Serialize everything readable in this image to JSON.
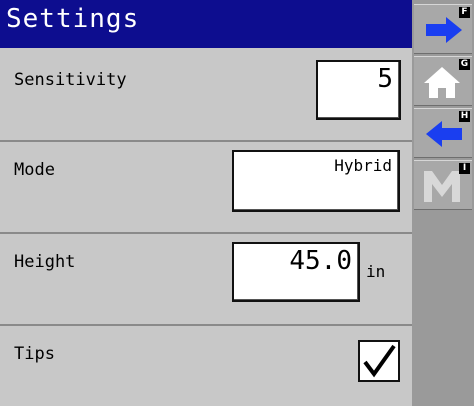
{
  "header": {
    "title": "Settings"
  },
  "settings": {
    "sensitivity": {
      "label": "Sensitivity",
      "value": "5"
    },
    "mode": {
      "label": "Mode",
      "value": "Hybrid"
    },
    "height": {
      "label": "Height",
      "value": "45.0",
      "unit": "in"
    },
    "tips": {
      "label": "Tips",
      "checked": true
    }
  },
  "sidebar": {
    "buttons": [
      {
        "key": "F",
        "icon": "arrow-right-icon"
      },
      {
        "key": "G",
        "icon": "home-icon"
      },
      {
        "key": "H",
        "icon": "arrow-left-icon"
      },
      {
        "key": "I",
        "icon": "menu-m-icon"
      }
    ]
  },
  "colors": {
    "title_bar": "#0d0d8f",
    "arrow_blue": "#1a3ef0",
    "background": "#c8c8c8"
  }
}
